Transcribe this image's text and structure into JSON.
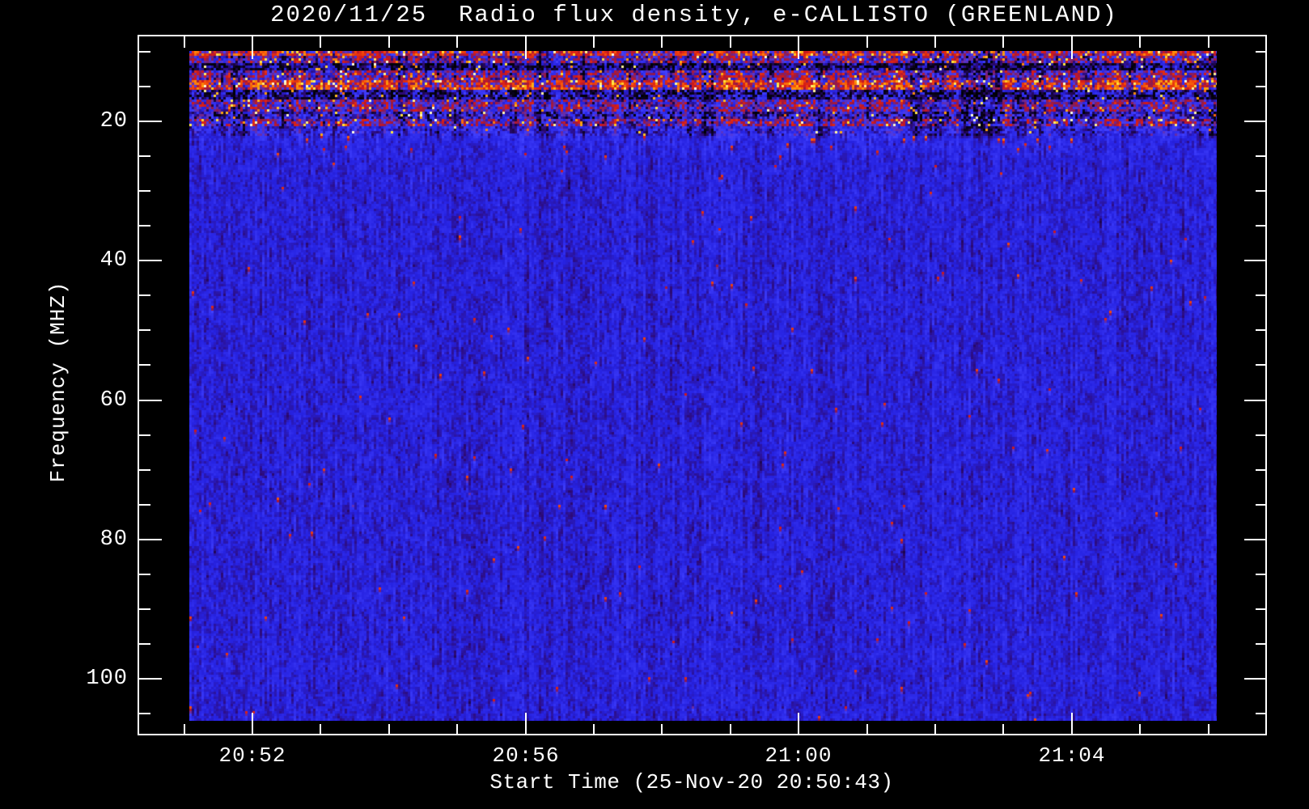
{
  "figure": {
    "title": "2020/11/25  Radio flux density, e-CALLISTO (GREENLAND)",
    "background_color": "#000000",
    "frame_color": "#ffffff",
    "station": "GREENLAND",
    "instrument": "e-CALLISTO",
    "date": "2020/11/25"
  },
  "chart_data": {
    "type": "heatmap",
    "subtype": "radio-spectrogram",
    "title": "2020/11/25  Radio flux density, e-CALLISTO (GREENLAND)",
    "xlabel": "Start Time (25-Nov-20 20:50:43)",
    "ylabel": "Frequency (MHZ)",
    "start_time": "25-Nov-20 20:50:43",
    "x_ticks_major": [
      {
        "label": "20:52",
        "minutes_after_20h": 52
      },
      {
        "label": "20:56",
        "minutes_after_20h": 56
      },
      {
        "label": "21:00",
        "minutes_after_20h": 60
      },
      {
        "label": "21:04",
        "minutes_after_20h": 64
      }
    ],
    "x_ticks_minor_minutes_after_20h": [
      51,
      53,
      54,
      55,
      57,
      58,
      59,
      61,
      62,
      63,
      65,
      66
    ],
    "x_axis_range_approx": [
      "20:50:20",
      "21:06:52"
    ],
    "y_ticks_major": [
      {
        "label": "20",
        "mhz": 20
      },
      {
        "label": "40",
        "mhz": 40
      },
      {
        "label": "60",
        "mhz": 60
      },
      {
        "label": "80",
        "mhz": 80
      },
      {
        "label": "100",
        "mhz": 100
      }
    ],
    "y_ticks_minor_mhz": [
      10,
      15,
      25,
      30,
      35,
      45,
      50,
      55,
      65,
      70,
      75,
      85,
      90,
      95,
      105
    ],
    "y_axis_range_mhz": [
      8,
      108
    ],
    "data_freq_range_mhz": [
      10,
      106
    ],
    "grid": false,
    "legend": null,
    "description": "Mostly uniform blue background (quiet radio flux) from ~23 to 106 MHz; strong banded RFI/ionospheric noise (red, orange, yellow, black dropout streaks) between 10 and ~23 MHz; sparse bright sparkles along ~22.5 MHz line; no solar burst visible.",
    "palette": [
      [
        0.0,
        "#000006"
      ],
      [
        0.07,
        "#0a021e"
      ],
      [
        0.14,
        "#2d0a78"
      ],
      [
        0.21,
        "#2622e1"
      ],
      [
        0.3,
        "#4040ff"
      ],
      [
        0.4,
        "#8c1950"
      ],
      [
        0.5,
        "#d21919"
      ],
      [
        0.65,
        "#f54a0a"
      ],
      [
        0.8,
        "#ffa00a"
      ],
      [
        0.9,
        "#ffe63c"
      ],
      [
        1.0,
        "#ffffe6"
      ]
    ],
    "noise_bands": [
      {
        "name": "rfi-strong-top",
        "f_lo_mhz": 10.0,
        "f_hi_mhz": 10.7,
        "level": 0.5,
        "noise": 0.22,
        "spike_prob": 0.1
      },
      {
        "name": "rfi-mixed-1",
        "f_lo_mhz": 10.7,
        "f_hi_mhz": 11.7,
        "level": 0.34,
        "noise": 0.2,
        "spike_prob": 0.05
      },
      {
        "name": "rfi-dark-1",
        "f_lo_mhz": 11.7,
        "f_hi_mhz": 12.7,
        "level": 0.13,
        "noise": 0.13,
        "spike_prob": 0.02
      },
      {
        "name": "rfi-mixed-2",
        "f_lo_mhz": 12.7,
        "f_hi_mhz": 14.2,
        "level": 0.35,
        "noise": 0.2,
        "spike_prob": 0.04
      },
      {
        "name": "rfi-strong-2",
        "f_lo_mhz": 14.2,
        "f_hi_mhz": 15.7,
        "level": 0.52,
        "noise": 0.24,
        "spike_prob": 0.12
      },
      {
        "name": "rfi-dark-2",
        "f_lo_mhz": 15.7,
        "f_hi_mhz": 16.9,
        "level": 0.16,
        "noise": 0.15,
        "spike_prob": 0.02
      },
      {
        "name": "rfi-mixed-3",
        "f_lo_mhz": 16.9,
        "f_hi_mhz": 18.6,
        "level": 0.34,
        "noise": 0.18,
        "spike_prob": 0.03
      },
      {
        "name": "rfi-dim",
        "f_lo_mhz": 18.6,
        "f_hi_mhz": 19.8,
        "level": 0.22,
        "noise": 0.16,
        "spike_prob": 0.02
      },
      {
        "name": "rfi-red-stripe",
        "f_lo_mhz": 19.8,
        "f_hi_mhz": 20.8,
        "level": 0.34,
        "noise": 0.2,
        "spike_prob": 0.05
      },
      {
        "name": "transition",
        "f_lo_mhz": 20.8,
        "f_hi_mhz": 22.2,
        "level": 0.24,
        "noise": 0.09,
        "spike_prob": 0.01
      },
      {
        "name": "sparkle-line",
        "f_lo_mhz": 22.2,
        "f_hi_mhz": 22.9,
        "level": 0.23,
        "noise": 0.07,
        "spike_prob": 0.015,
        "bright": true
      },
      {
        "name": "upper-body",
        "f_lo_mhz": 22.9,
        "f_hi_mhz": 25.0,
        "level": 0.22,
        "noise": 0.07,
        "spike_prob": 0.004
      },
      {
        "name": "quiet-body",
        "f_lo_mhz": 25.0,
        "f_hi_mhz": 106.0,
        "level": 0.21,
        "noise": 0.065,
        "spike_prob": 0.0015
      }
    ]
  }
}
